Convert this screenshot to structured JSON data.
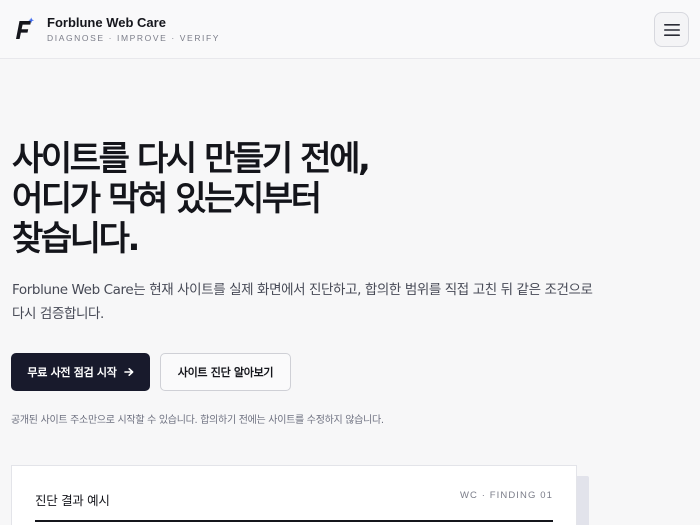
{
  "header": {
    "brand_name": "Forblune Web Care",
    "tagline": "DIAGNOSE · IMPROVE · VERIFY",
    "logo_icon": "forblune-f-logo",
    "menu_icon": "hamburger-menu-icon"
  },
  "hero": {
    "headline_lines": [
      "사이트를 다시 만들기 전에,",
      "어디가 막혀 있는지부터",
      "찾습니다."
    ],
    "description_lines": [
      "Forblune Web Care는 현재 사이트를 실제 화면에서 진단하고, 합의한 범위를 직접 고친 뒤 같은 조건으로",
      "다시 검증합니다."
    ],
    "primary_button": "무료 사전 점검 시작",
    "primary_button_icon": "arrow-right-icon",
    "secondary_button": "사이트 진단 알아보기",
    "note": "공개된 사이트 주소만으로 시작할 수 있습니다. 합의하기 전에는 사이트를 수정하지 않습니다."
  },
  "finding_card": {
    "title": "진단 결과 예시",
    "code": "WC · FINDING 01"
  },
  "colors": {
    "primary_button_bg": "#181a2c",
    "logo_accent": "#3f6bf0",
    "text": "#15161c",
    "muted": "#7b7d89"
  }
}
